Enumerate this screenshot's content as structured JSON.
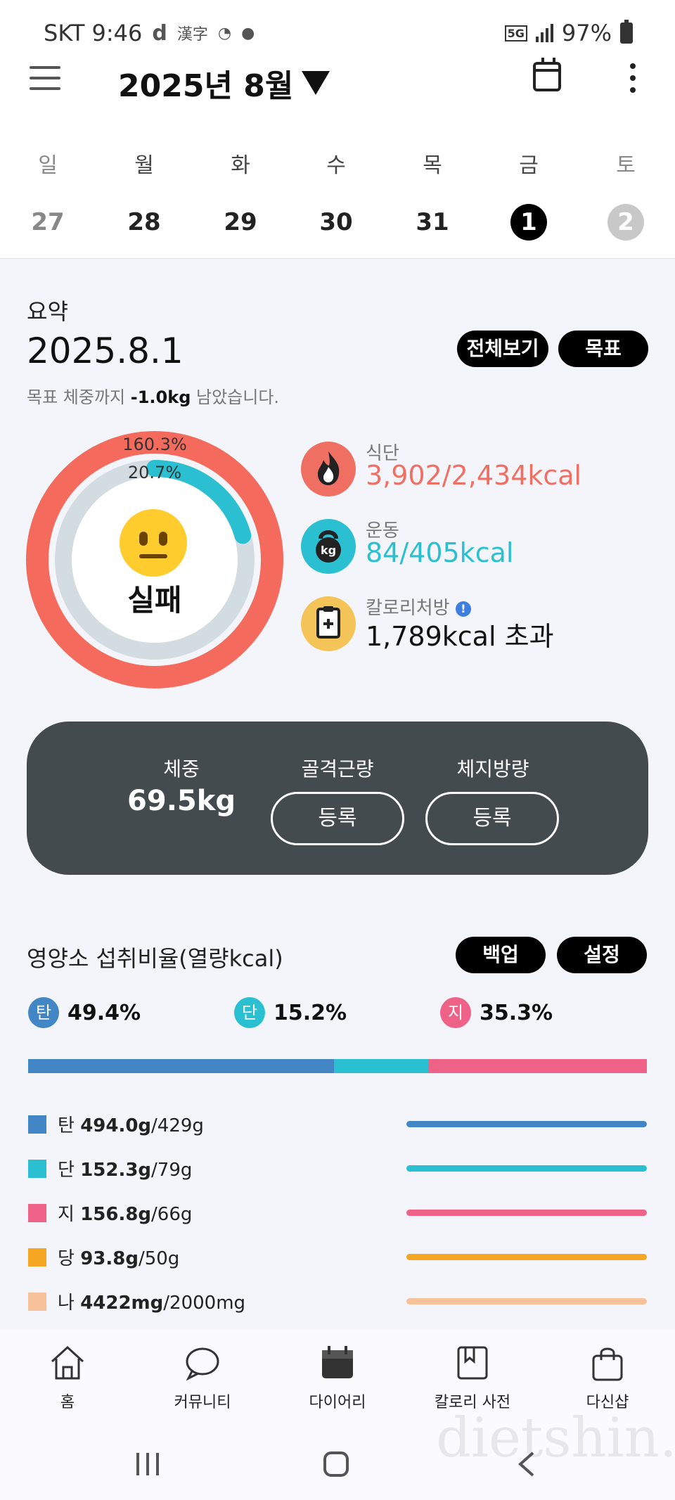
{
  "status_bar": {
    "carrier_time": "SKT 9:46",
    "network": "5G",
    "battery": "97%"
  },
  "header": {
    "month_title": "2025년 8월"
  },
  "week": {
    "day_names": [
      "일",
      "월",
      "화",
      "수",
      "목",
      "금",
      "토"
    ],
    "dates": [
      "27",
      "28",
      "29",
      "30",
      "31",
      "1",
      "2"
    ],
    "selected_index": 5
  },
  "summary": {
    "label": "요약",
    "date": "2025.8.1",
    "all_view_button": "전체보기",
    "goal_button": "목표",
    "goal_prefix": "목표 체중까지 ",
    "goal_remaining": "-1.0kg",
    "goal_suffix": " 남았습니다.",
    "ring": {
      "outer_pct_label": "160.3%",
      "inner_pct_label": "20.7%",
      "outer_pct": 160.3,
      "inner_pct": 20.7,
      "status": "실패"
    },
    "stats": [
      {
        "label": "식단",
        "value": "3,902/2,434kcal",
        "color": "#f06f63",
        "icon": "fire-icon"
      },
      {
        "label": "운동",
        "value": "84/405kcal",
        "color": "#2bbfd2",
        "icon": "kettlebell-icon"
      },
      {
        "label": "칼로리처방",
        "value": "1,789kcal 초과",
        "color": "#111111",
        "icon": "clipboard-icon"
      }
    ]
  },
  "body": {
    "weight_label": "체중",
    "weight_value": "69.5kg",
    "muscle_label": "골격근량",
    "muscle_button": "등록",
    "fat_label": "체지방량",
    "fat_button": "등록"
  },
  "nutrition": {
    "title": "영양소 섭취비율(열량kcal)",
    "backup_button": "백업",
    "settings_button": "설정",
    "ratios": [
      {
        "badge": "탄",
        "value": "49.4%",
        "pct": 49.4,
        "color": "#4286c6"
      },
      {
        "badge": "단",
        "value": "15.2%",
        "pct": 15.2,
        "color": "#2bbfd2"
      },
      {
        "badge": "지",
        "value": "35.3%",
        "pct": 35.3,
        "color": "#ef6288"
      }
    ],
    "rows": [
      {
        "name": "탄",
        "amount": "494.0g",
        "target": "/429g",
        "color": "#4286c6"
      },
      {
        "name": "단",
        "amount": "152.3g",
        "target": "/79g",
        "color": "#2bbfd2"
      },
      {
        "name": "지",
        "amount": "156.8g",
        "target": "/66g",
        "color": "#ef6288"
      },
      {
        "name": "당",
        "amount": "93.8g",
        "target": "/50g",
        "color": "#f5a623"
      },
      {
        "name": "나",
        "amount": "4422mg",
        "target": "/2000mg",
        "color": "#f7c29a"
      }
    ]
  },
  "bottom_nav": {
    "items": [
      {
        "label": "홈",
        "icon": "home-icon"
      },
      {
        "label": "커뮤니티",
        "icon": "chat-bubble-icon"
      },
      {
        "label": "다이어리",
        "icon": "calendar-icon"
      },
      {
        "label": "칼로리 사전",
        "icon": "book-icon"
      },
      {
        "label": "다신샵",
        "icon": "shopping-bag-icon"
      }
    ]
  },
  "watermark": "dietshin.com"
}
